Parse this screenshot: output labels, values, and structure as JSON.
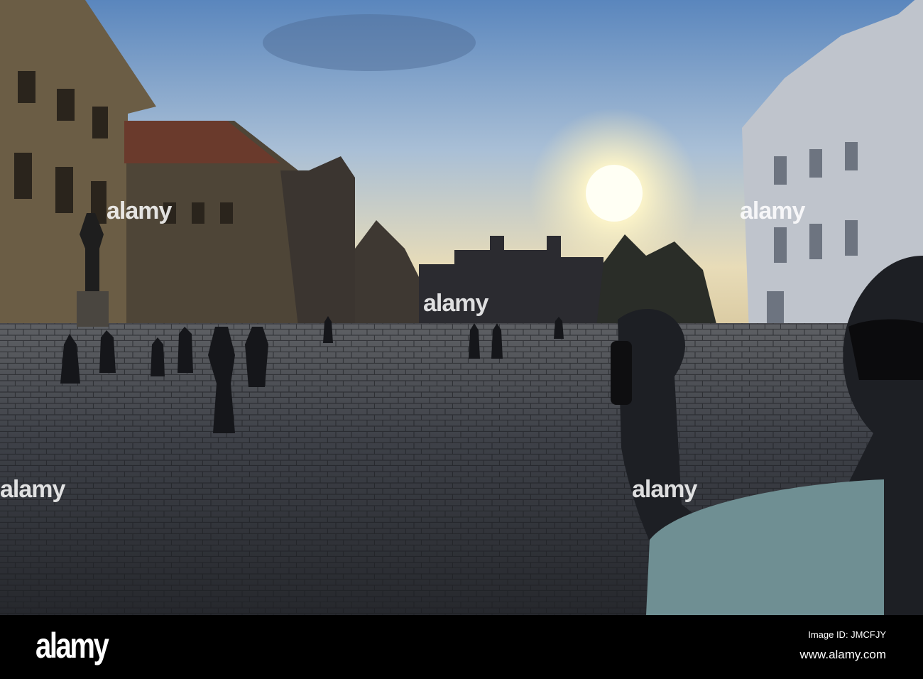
{
  "watermark": {
    "text": "alamy"
  },
  "footer": {
    "logo": "alamy",
    "image_id": "Image ID: JMCFJY",
    "website": "www.alamy.com"
  }
}
